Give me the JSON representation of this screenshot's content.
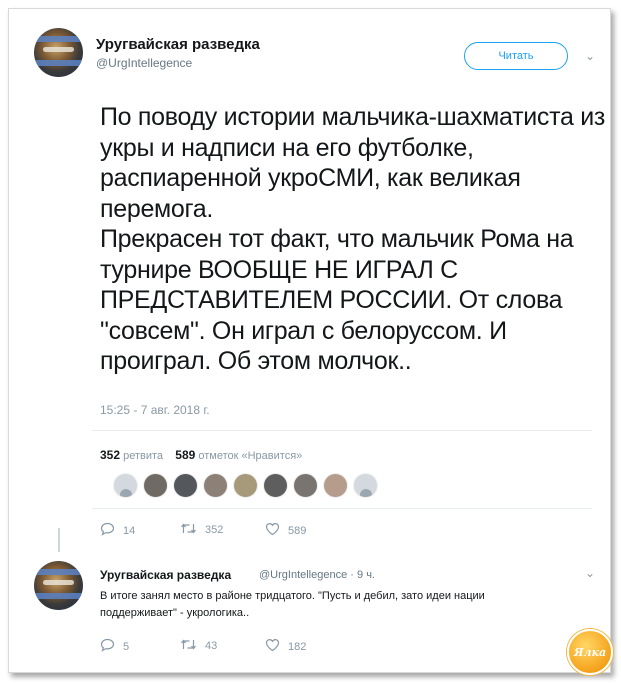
{
  "tweet": {
    "author_name": "Уругвайская разведка",
    "author_handle": "@UrgIntellegence",
    "follow_label": "Читать",
    "text_paragraphs": [
      "По поводу истории мальчика-шахматиста из укры и надписи на его футболке, распиаренной укроСМИ, как великая перемога.",
      "Прекрасен тот факт, что мальчик Рома на турнире ВООБЩЕ НЕ ИГРАЛ С ПРЕДСТАВИТЕЛЕМ РОССИИ. От слова \"совсем\". Он играл с белоруссом. И проиграл. Об этом молчок.."
    ],
    "timestamp": "15:25 - 7 авг. 2018 г.",
    "retweets_count": "352",
    "retweets_label": "ретвита",
    "likes_count": "589",
    "likes_label": "отметок «Нравится»",
    "actions": {
      "reply_count": "14",
      "retweet_count": "352",
      "like_count": "589"
    }
  },
  "reply": {
    "author_name": "Уругвайская разведка",
    "author_handle": "@UrgIntellegence",
    "time_ago": "9 ч.",
    "text_lines": [
      "В итоге занял место в районе тридцатого. \"Пусть и дебил, зато идеи нации",
      "поддерживает\" - укрологика.."
    ],
    "actions": {
      "reply_count": "5",
      "retweet_count": "43",
      "like_count": "182"
    }
  },
  "watermark": "Ялка",
  "colors": {
    "accent": "#1da1f2",
    "text": "#14171a",
    "muted": "#8899a6"
  },
  "icons": {
    "reply": "reply-icon",
    "retweet": "retweet-icon",
    "like": "heart-icon",
    "more": "chevron-down-icon"
  }
}
